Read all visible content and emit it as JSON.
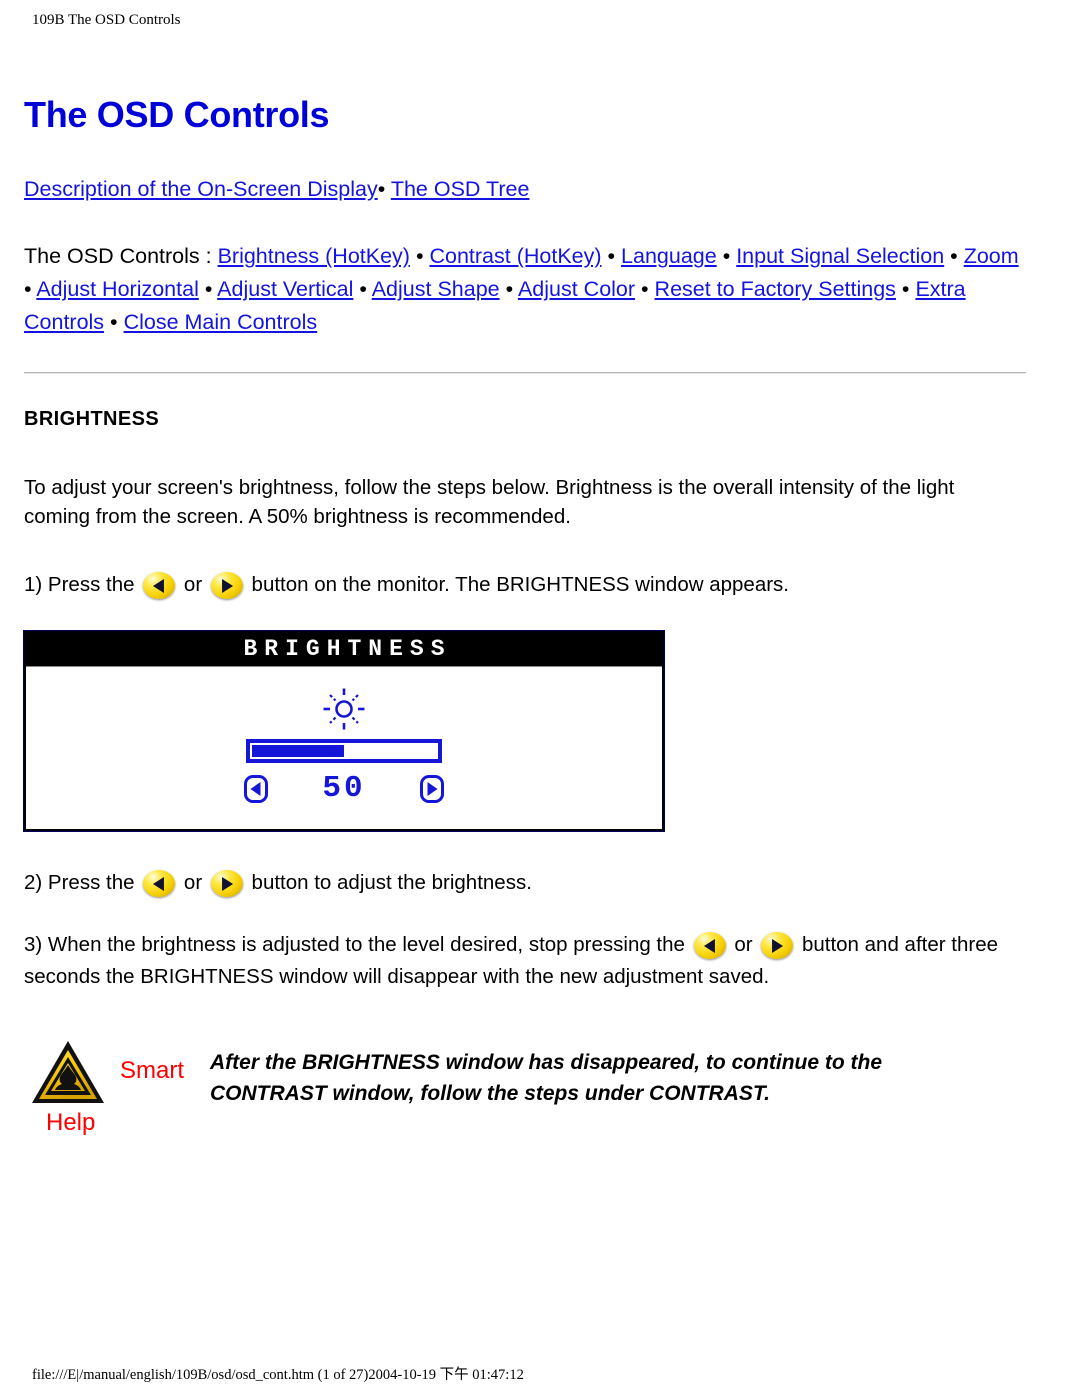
{
  "page": {
    "header": "109B The OSD Controls",
    "footer": "file:///E|/manual/english/109B/osd/osd_cont.htm (1 of 27)2004-10-19 下午 01:47:12",
    "title": "The OSD Controls",
    "title_color": "#0000d8",
    "link_color": "#1414e0"
  },
  "nav": {
    "link1": "Description of the On-Screen Display",
    "bullet": "•",
    "link2": "The OSD Tree"
  },
  "toc": {
    "intro": "The OSD Controls : ",
    "bullet": "•",
    "links": [
      "Brightness (HotKey)",
      "Contrast (HotKey)",
      "Language",
      "Input Signal Selection",
      "Zoom",
      "Adjust Horizontal",
      "Adjust Vertical",
      "Adjust Shape",
      "Adjust Color",
      "Reset to Factory Settings",
      "Extra Controls",
      "Close Main Controls"
    ]
  },
  "section": {
    "heading": "BRIGHTNESS",
    "intro": "To adjust your screen's brightness, follow the steps below. Brightness is the overall intensity of the light coming from the screen. A 50% brightness is recommended.",
    "step1_a": "1) Press the ",
    "step1_or": " or ",
    "step1_b": " button on the monitor. The BRIGHTNESS window appears.",
    "step2_a": "2) Press the ",
    "step2_or": " or ",
    "step2_b": " button to adjust the brightness.",
    "step3_a": "3) When the brightness is adjusted to the level desired, stop pressing the ",
    "step3_or": " or ",
    "step3_b": " button and after three seconds the BRIGHTNESS window will disappear with the new adjustment saved."
  },
  "osd_window": {
    "title": "BRIGHTNESS",
    "value": "50",
    "fill_percent": 50,
    "icon": "sun-brightness-icon",
    "bar_color": "#1616d8",
    "titlebar_bg": "#000000",
    "titlebar_fg": "#ffffff"
  },
  "smart_help": {
    "icon": "warning-triangle-icon",
    "label_smart": "Smart",
    "label_help": "Help",
    "label_color": "#ff0000",
    "text": "After the BRIGHTNESS window has disappeared, to continue to the CONTRAST window, follow the steps under CONTRAST."
  }
}
